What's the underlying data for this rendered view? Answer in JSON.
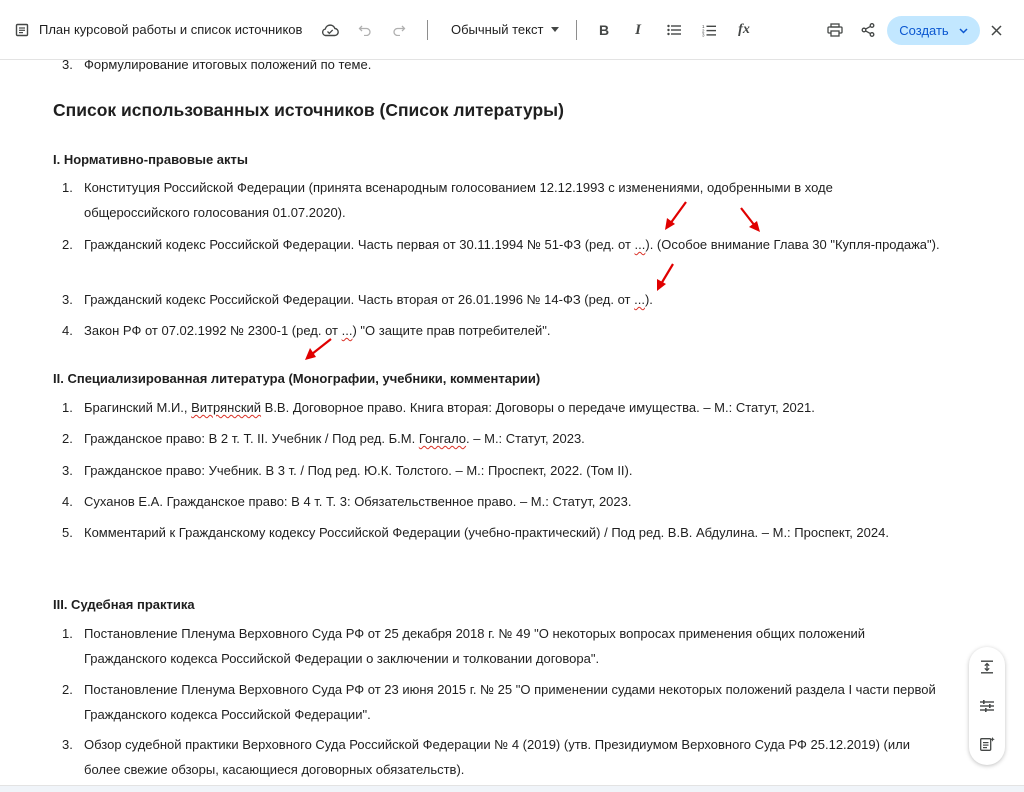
{
  "toolbar": {
    "title": "План курсовой работы и список источников",
    "style_select": "Обычный текст",
    "create_label": "Создать"
  },
  "content": {
    "prev_item_num": "3.",
    "prev_item_text": "Формулирование итоговых положений по теме.",
    "heading": "Список использованных источников (Список литературы)",
    "sections": [
      {
        "title": "I. Нормативно-правовые акты",
        "items": [
          {
            "num": "1.",
            "text": "Конституция Российской Федерации (принята всенародным голосованием 12.12.1993 с изменениями, одобренными в ходе общероссийского голосования 01.07.2020)."
          },
          {
            "num": "2.",
            "text_a": "Гражданский кодекс Российской Федерации. Часть первая от 30.11.1994 № 51-ФЗ (ред. от ",
            "text_b": "...",
            "text_c": "). (Особое внимание Глава 30 \"Купля-продажа\")."
          },
          {
            "num": "3.",
            "text_a": "Гражданский кодекс Российской Федерации. Часть вторая от 26.01.1996 № 14-ФЗ (ред. от ",
            "text_b": "...",
            "text_c": ")."
          },
          {
            "num": "4.",
            "text_a": "Закон РФ от 07.02.1992 № 2300-1 (ред. от ",
            "text_b": "...",
            "text_c": ") \"О защите прав потребителей\"."
          }
        ]
      },
      {
        "title": "II. Специализированная литература (Монографии, учебники, комментарии)",
        "items": [
          {
            "num": "1.",
            "text_a": "Брагинский М.И., ",
            "text_b": "Витрянский",
            "text_c": " В.В. Договорное право. Книга вторая: Договоры о передаче имущества. – М.: Статут, 2021."
          },
          {
            "num": "2.",
            "text_a": "Гражданское право: В 2 т. Т. II. Учебник / Под ред. Б.М. ",
            "text_b": "Гонгало",
            "text_c": ". – М.: Статут, 2023."
          },
          {
            "num": "3.",
            "text": "Гражданское право: Учебник. В 3 т. / Под ред. Ю.К. Толстого. – М.: Проспект, 2022. (Том II)."
          },
          {
            "num": "4.",
            "text": "Суханов Е.А. Гражданское право: В 4 т. Т. 3: Обязательственное право. – М.: Статут, 2023."
          },
          {
            "num": "5.",
            "text": "Комментарий к Гражданскому кодексу Российской Федерации (учебно-практический) / Под ред. В.В. Абдулина. – М.: Проспект, 2024."
          }
        ]
      },
      {
        "title": "III. Судебная практика",
        "items": [
          {
            "num": "1.",
            "text": "Постановление Пленума Верховного Суда РФ от 25 декабря 2018 г. № 49 \"О некоторых вопросах применения общих положений Гражданского кодекса Российской Федерации о заключении и толковании договора\"."
          },
          {
            "num": "2.",
            "text": "Постановление Пленума Верховного Суда РФ от 23 июня 2015 г. № 25 \"О применении судами некоторых положений раздела I части первой Гражданского кодекса Российской Федерации\"."
          },
          {
            "num": "3.",
            "text": "Обзор судебной практики Верховного Суда Российской Федерации № 4 (2019) (утв. Президиумом Верховного Суда РФ 25.12.2019) (или более свежие обзоры, касающиеся договорных обязательств)."
          }
        ]
      }
    ]
  }
}
